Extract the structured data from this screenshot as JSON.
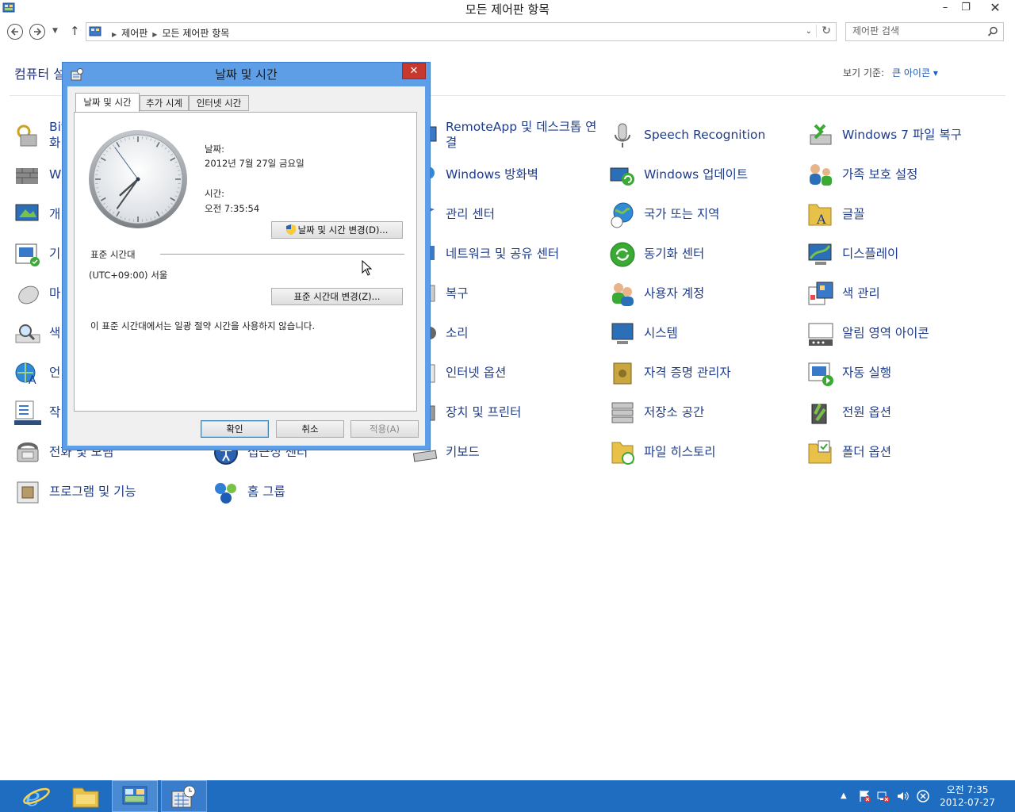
{
  "window": {
    "title": "모든 제어판 항목",
    "min_glyph": "–",
    "max_glyph": "❐",
    "close_glyph": "✕"
  },
  "nav": {
    "breadcrumb": [
      "제어판",
      "모든 제어판 항목"
    ],
    "search_placeholder": "제어판 검색"
  },
  "content": {
    "heading": "컴퓨터 설정 조정",
    "viewby_label": "보기 기준:",
    "viewby_value": "큰 아이콘 ▾"
  },
  "items": {
    "c0": [
      "Bit",
      "W",
      "개",
      "기",
      "마",
      "색",
      "언",
      "작",
      "전화 및 모뎀",
      "프로그램 및 기능"
    ],
    "c0_second_line": "화",
    "c1": [
      "접근성 센터",
      "홈 그룹"
    ],
    "c2": [
      "RemoteApp 및 데스크톱 연결",
      "Windows 방화벽",
      "관리 센터",
      "네트워크 및 공유 센터",
      "복구",
      "소리",
      "인터넷 옵션",
      "장치 및 프린터",
      "키보드"
    ],
    "c3": [
      "Speech Recognition",
      "Windows 업데이트",
      "국가 또는 지역",
      "동기화 센터",
      "사용자 계정",
      "시스템",
      "자격 증명 관리자",
      "저장소 공간",
      "파일 히스토리"
    ],
    "c4": [
      "Windows 7 파일 복구",
      "가족 보호 설정",
      "글꼴",
      "디스플레이",
      "색 관리",
      "알림 영역 아이콘",
      "자동 실행",
      "전원 옵션",
      "폴더 옵션"
    ]
  },
  "dialog": {
    "title": "날짜 및 시간",
    "tabs": [
      "날짜 및 시간",
      "추가 시계",
      "인터넷 시간"
    ],
    "date_label": "날짜:",
    "date_value": "2012년 7월 27일 금요일",
    "time_label": "시간:",
    "time_value": "오전 7:35:54",
    "change_datetime_btn": "날짜 및 시간 변경(D)...",
    "timezone_group": "표준 시간대",
    "timezone_value": "(UTC+09:00) 서울",
    "change_timezone_btn": "표준 시간대 변경(Z)...",
    "dst_note": "이 표준 시간대에서는 일광 절약 시간을 사용하지 않습니다.",
    "ok": "확인",
    "cancel": "취소",
    "apply": "적용(A)",
    "clock_hours": 7,
    "clock_minutes": 35,
    "clock_seconds": 54
  },
  "taskbar": {
    "time": "오전 7:35",
    "date": "2012-07-27"
  },
  "colors": {
    "link": "#1e3c8c",
    "dialog_frame": "#5e9ee6",
    "close_red": "#c7382e",
    "taskbar": "#1f6dc0"
  }
}
